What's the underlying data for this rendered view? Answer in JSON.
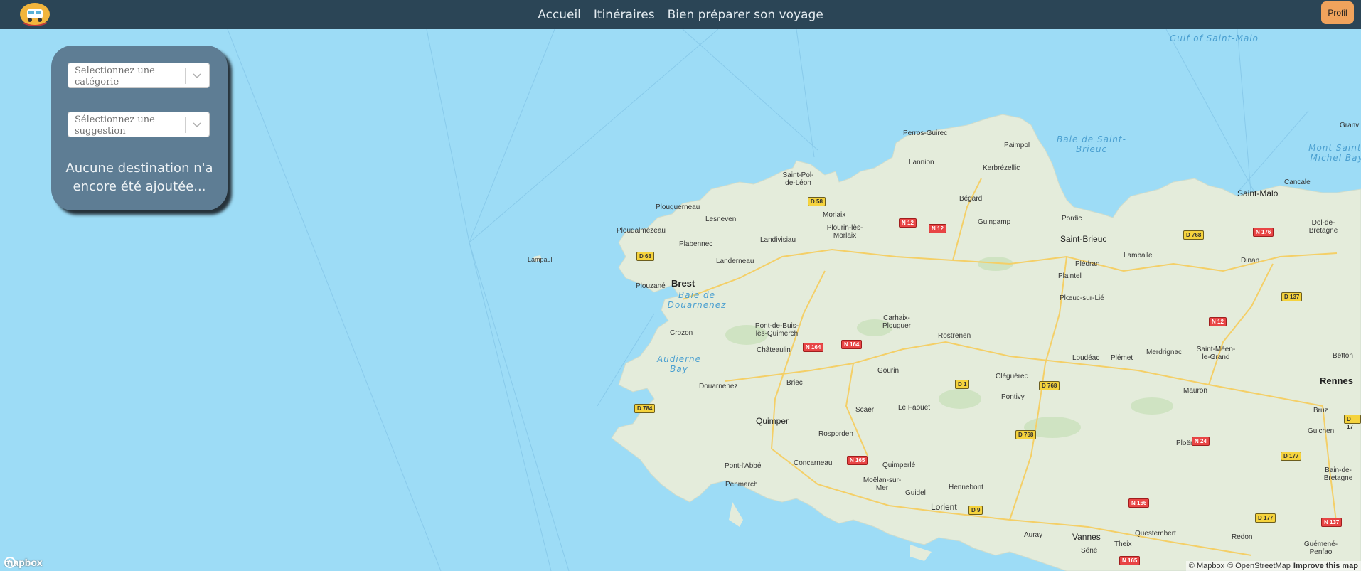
{
  "nav": {
    "links": [
      "Accueil",
      "Itinéraires",
      "Bien préparer son voyage"
    ],
    "profile_button": "Profil"
  },
  "panel": {
    "category_placeholder": "Selectionnez une catégorie",
    "suggestion_placeholder": "Sélectionnez une suggestion",
    "empty_message": "Aucune destination n'a encore été ajoutée..."
  },
  "map": {
    "water_labels": [
      "Gulf of Saint-Malo",
      "Baie de Saint-Brieuc",
      "Baie de Douarnenez",
      "Audierne Bay",
      "Mont Saint-Michel Bay"
    ],
    "cities": [
      "Perros-Guirec",
      "Paimpol",
      "Lannion",
      "Kerbrézellic",
      "Saint-Pol-de-Léon",
      "Plouguerneau",
      "Lesneven",
      "Morlaix",
      "Plourin-lès-Morlaix",
      "Bégard",
      "Guingamp",
      "Pordic",
      "Saint-Brieuc",
      "Saint-Malo",
      "Cancale",
      "Dol-de-Bretagne",
      "Ploudalmézeau",
      "Plabennec",
      "Landivisiau",
      "Landerneau",
      "Lampaul",
      "Brest",
      "Plouzané",
      "Plédran",
      "Lamballe",
      "Dinan",
      "Plaintel",
      "Plœuc-sur-Lié",
      "Crozon",
      "Pont-de-Buis-lès-Quimerch",
      "Châteaulin",
      "Carhaix-Plouguer",
      "Rostrenen",
      "Loudéac",
      "Plémet",
      "Merdrignac",
      "Saint-Méen-le-Grand",
      "Betton",
      "Rennes",
      "Douarnenez",
      "Brieс",
      "Gourin",
      "Cléguérec",
      "Pontivy",
      "Mauron",
      "Scaër",
      "Le Faouët",
      "Quimper",
      "Rosporden",
      "Bruz",
      "Guichen",
      "Ploërmel",
      "Bain-de-Bretagne",
      "Pont-l'Abbé",
      "Concarneau",
      "Quimperlé",
      "Penmarch",
      "Moëlan-sur-Mer",
      "Guidel",
      "Hennebont",
      "Lorient",
      "Auray",
      "Vannes",
      "Séné",
      "Theix",
      "Questembert",
      "Redon",
      "Guémené-Penfao",
      "Granv"
    ],
    "roads_yellow": [
      "D 58",
      "D 68",
      "D 768",
      "D 137",
      "D 1",
      "D 768",
      "D 784",
      "D 768",
      "D 177",
      "D 9",
      "D 177",
      "D 17"
    ],
    "roads_red": [
      "N 12",
      "N 12",
      "N 176",
      "N 12",
      "N 164",
      "N 164",
      "N 165",
      "N 24",
      "N 166",
      "N 137",
      "N 165"
    ],
    "attribution": [
      "© Mapbox",
      "© OpenStreetMap",
      "Improve this map"
    ],
    "logo_text": "mapbox"
  },
  "colors": {
    "navbar": "#2b4556",
    "water": "#9ddcf6",
    "land": "#e4ecdb",
    "panel": "#5e7d94",
    "profile_button": "#f0a35c"
  }
}
